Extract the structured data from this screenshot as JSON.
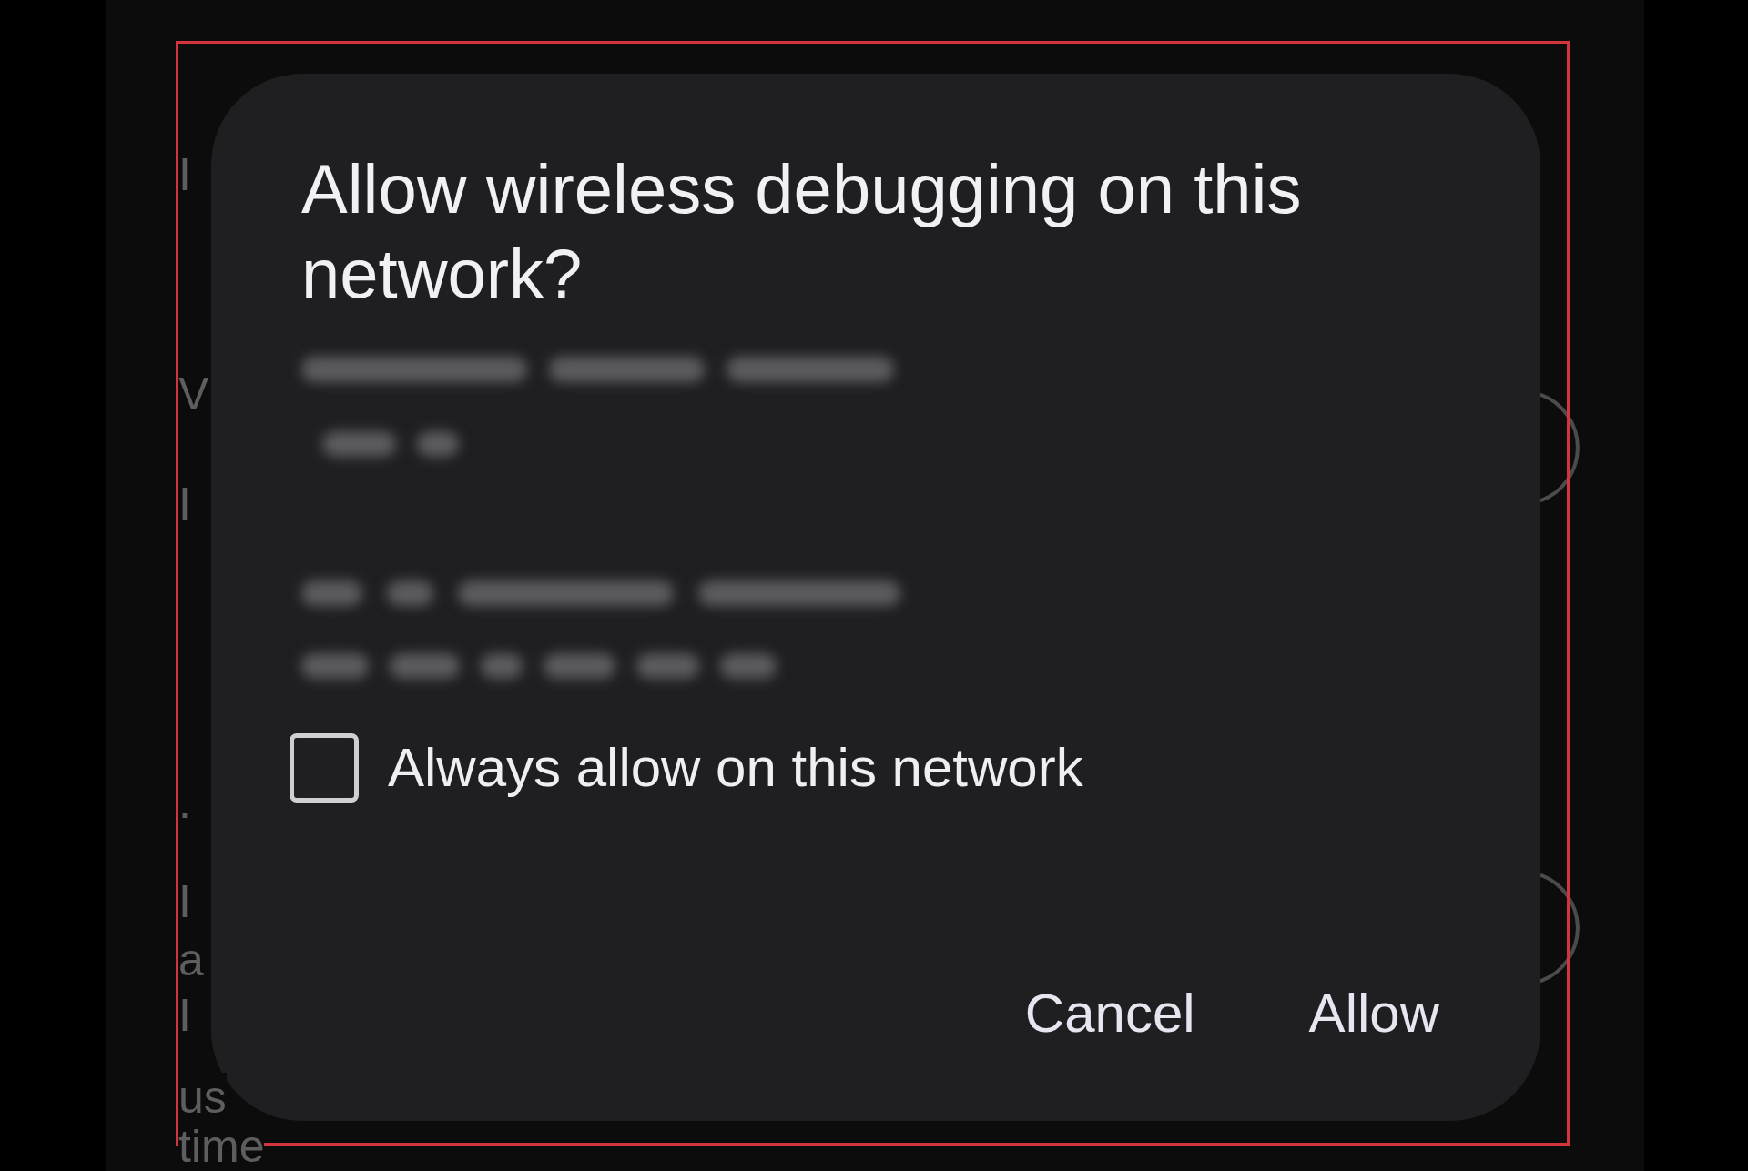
{
  "background": {
    "fragments": [
      "I",
      "V",
      "I",
      ".",
      "I",
      "a",
      "I",
      "us",
      "time"
    ],
    "switches": [
      {
        "on": false
      },
      {
        "on": false
      }
    ]
  },
  "dialog": {
    "title": "Allow wireless debugging on this network?",
    "checkbox": {
      "label": "Always allow on this network",
      "checked": false
    },
    "buttons": [
      "Cancel",
      "Allow"
    ]
  }
}
